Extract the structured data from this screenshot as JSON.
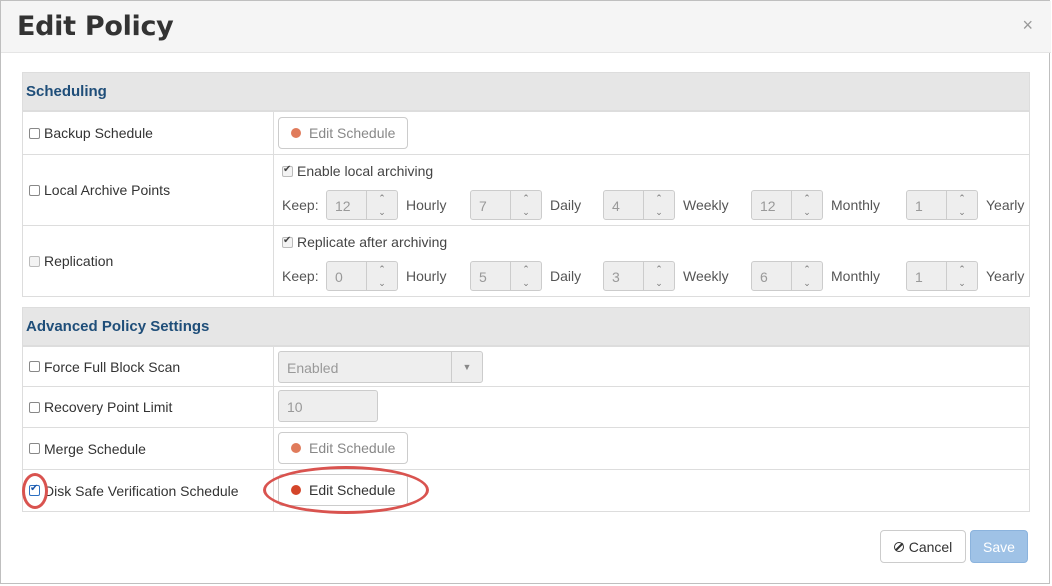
{
  "dialog": {
    "title": "Edit Policy",
    "close_glyph": "×"
  },
  "scheduling": {
    "heading": "Scheduling",
    "backup": {
      "label": "Backup Schedule",
      "button": "Edit Schedule"
    },
    "local_archive": {
      "label": "Local Archive Points",
      "enable_label": "Enable local archiving",
      "keep_label": "Keep:",
      "hourly": "12",
      "hourly_label": "Hourly",
      "daily": "7",
      "daily_label": "Daily",
      "weekly": "4",
      "weekly_label": "Weekly",
      "monthly": "12",
      "monthly_label": "Monthly",
      "yearly": "1",
      "yearly_label": "Yearly"
    },
    "replication": {
      "label": "Replication",
      "enable_label": "Replicate after archiving",
      "keep_label": "Keep:",
      "hourly": "0",
      "hourly_label": "Hourly",
      "daily": "5",
      "daily_label": "Daily",
      "weekly": "3",
      "weekly_label": "Weekly",
      "monthly": "6",
      "monthly_label": "Monthly",
      "yearly": "1",
      "yearly_label": "Yearly"
    }
  },
  "advanced": {
    "heading": "Advanced Policy Settings",
    "force_full": {
      "label": "Force Full Block Scan",
      "value": "Enabled"
    },
    "recovery_limit": {
      "label": "Recovery Point Limit",
      "value": "10"
    },
    "merge": {
      "label": "Merge Schedule",
      "button": "Edit Schedule"
    },
    "disk_safe": {
      "label": "Disk Safe Verification Schedule",
      "button": "Edit Schedule",
      "checked": true
    }
  },
  "footer": {
    "cancel_label": "Cancel",
    "save_label": "Save"
  },
  "icons": {
    "spin_up": "⌃",
    "spin_down": "⌄",
    "caret": "▼"
  },
  "colors": {
    "accent": "#1f4e79",
    "highlight_ring": "#d9534f",
    "save": "#9fc2e6"
  }
}
